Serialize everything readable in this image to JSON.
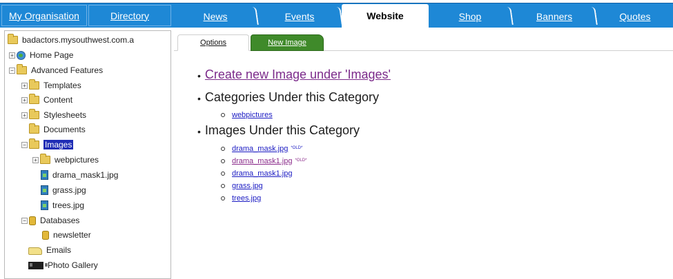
{
  "topnav": {
    "tabs": [
      {
        "label": "My Organisation"
      },
      {
        "label": "Directory"
      },
      {
        "label": "News"
      },
      {
        "label": "Events"
      },
      {
        "label": "Website"
      },
      {
        "label": "Shop"
      },
      {
        "label": "Banners"
      },
      {
        "label": "Quotes"
      }
    ],
    "active_tab": "Website",
    "bar_color": "#1e88d6"
  },
  "tree": {
    "root": "badactors.mysouthwest.com.a",
    "items": [
      {
        "label": "Home Page",
        "icon": "home-page-icon"
      },
      {
        "label": "Advanced Features",
        "icon": "folder-icon"
      },
      {
        "label": "Templates",
        "icon": "folder-icon"
      },
      {
        "label": "Content",
        "icon": "folder-icon"
      },
      {
        "label": "Stylesheets",
        "icon": "folder-icon"
      },
      {
        "label": "Documents",
        "icon": "folder-icon"
      },
      {
        "label": "Images",
        "icon": "folder-icon",
        "selected": true
      },
      {
        "label": "webpictures",
        "icon": "folder-icon"
      },
      {
        "label": "drama_mask1.jpg",
        "icon": "image-file-icon"
      },
      {
        "label": "grass.jpg",
        "icon": "image-file-icon"
      },
      {
        "label": "trees.jpg",
        "icon": "image-file-icon"
      },
      {
        "label": "Databases",
        "icon": "database-icon"
      },
      {
        "label": "newsletter",
        "icon": "database-icon"
      },
      {
        "label": "Emails",
        "icon": "email-icon"
      },
      {
        "label": "Photo Gallery",
        "icon": "photo-gallery-icon"
      }
    ],
    "expand_plus": "+",
    "expand_minus": "−",
    "selected_color": "#1f2db5"
  },
  "main": {
    "subtabs": {
      "options": "Options",
      "new_image": "New Image"
    },
    "bullet": "•",
    "create_link": "Create new Image under 'Images'",
    "categories_heading": "Categories Under this Category",
    "categories": [
      "webpictures"
    ],
    "images_heading": "Images Under this Category",
    "images": [
      {
        "name": "drama_mask.jpg",
        "tag": "*OLD*"
      },
      {
        "name": "drama_mask1.jpg",
        "tag": "*OLD*"
      },
      {
        "name": "drama_mask1.jpg",
        "tag": ""
      },
      {
        "name": "grass.jpg",
        "tag": ""
      },
      {
        "name": "trees.jpg",
        "tag": ""
      }
    ],
    "new_image_tab_color": "#3f8a2a"
  }
}
